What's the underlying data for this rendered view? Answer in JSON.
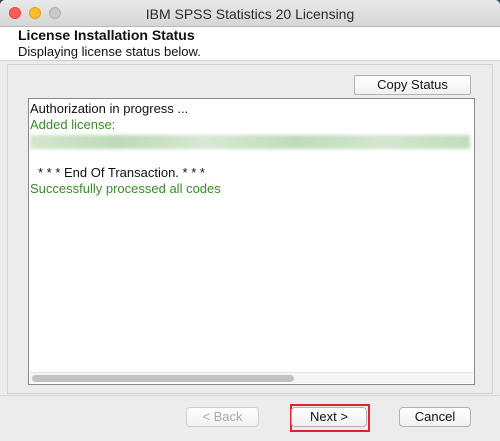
{
  "window": {
    "title": "IBM SPSS Statistics 20 Licensing"
  },
  "header": {
    "title": "License Installation Status",
    "subtitle": "Displaying license status below."
  },
  "toolbar": {
    "copy_status_label": "Copy Status"
  },
  "status_log": {
    "line1": "Authorization in progress ...",
    "line2": "Added license:",
    "line4": "* * * End Of Transaction. * * *",
    "line5": "Successfully processed all codes"
  },
  "footer": {
    "back_label": "< Back",
    "next_label": "Next >",
    "cancel_label": "Cancel"
  },
  "colors": {
    "success_text": "#3a8a2a",
    "highlight_border": "#e0242b",
    "close": "#fc5f57",
    "minimize": "#fdbc2e",
    "zoom_inactive": "#c9c9c9"
  },
  "icons": [
    "close-window-icon",
    "minimize-window-icon",
    "zoom-window-icon"
  ]
}
